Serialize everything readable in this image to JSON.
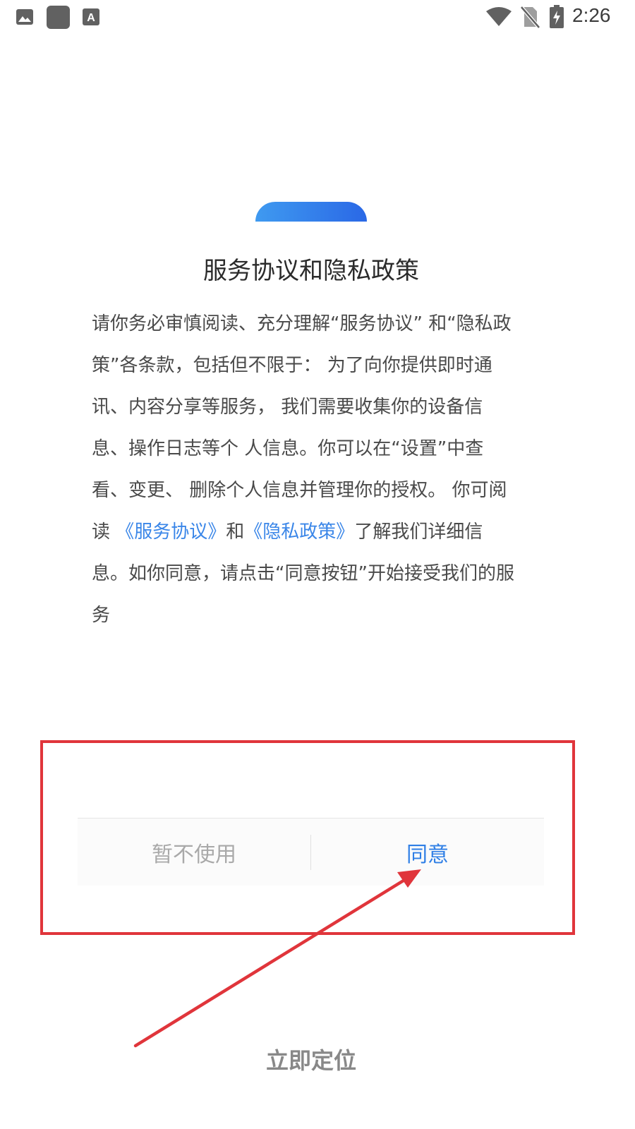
{
  "status_bar": {
    "time": "2:26",
    "icons": [
      "gallery-icon",
      "app-square-icon",
      "font-a-icon",
      "wifi-icon",
      "no-sim-icon",
      "battery-charging-icon"
    ]
  },
  "dialog": {
    "title": "服务协议和隐私政策",
    "body_lines": {
      "l1": "请你务必审慎阅读、充分理解“服务协议” 和“隐私政",
      "l2": "策”各条款，包括但不限于： 为了向你提供即时通",
      "l3": "讯、内容分享等服务， 我们需要收集你的设备信",
      "l4": "息、操作日志等个 人信息。你可以在“设置”中查",
      "l5": "看、变更、 删除个人信息并管理你的授权。 你可阅",
      "l6_prefix": "读 ",
      "l6_link1": "《服务协议》",
      "l6_mid": "和",
      "l6_link2": "《隐私政策》",
      "l6_suffix": "了解我们详细信",
      "l7": "息。如你同意，请点击“同意按钮”开始接受我们的服",
      "l8": "务"
    },
    "decline_label": "暂不使用",
    "agree_label": "同意"
  },
  "bottom_text": "立即定位",
  "colors": {
    "accent": "#2f7fe6",
    "annotation": "#e0353b"
  }
}
